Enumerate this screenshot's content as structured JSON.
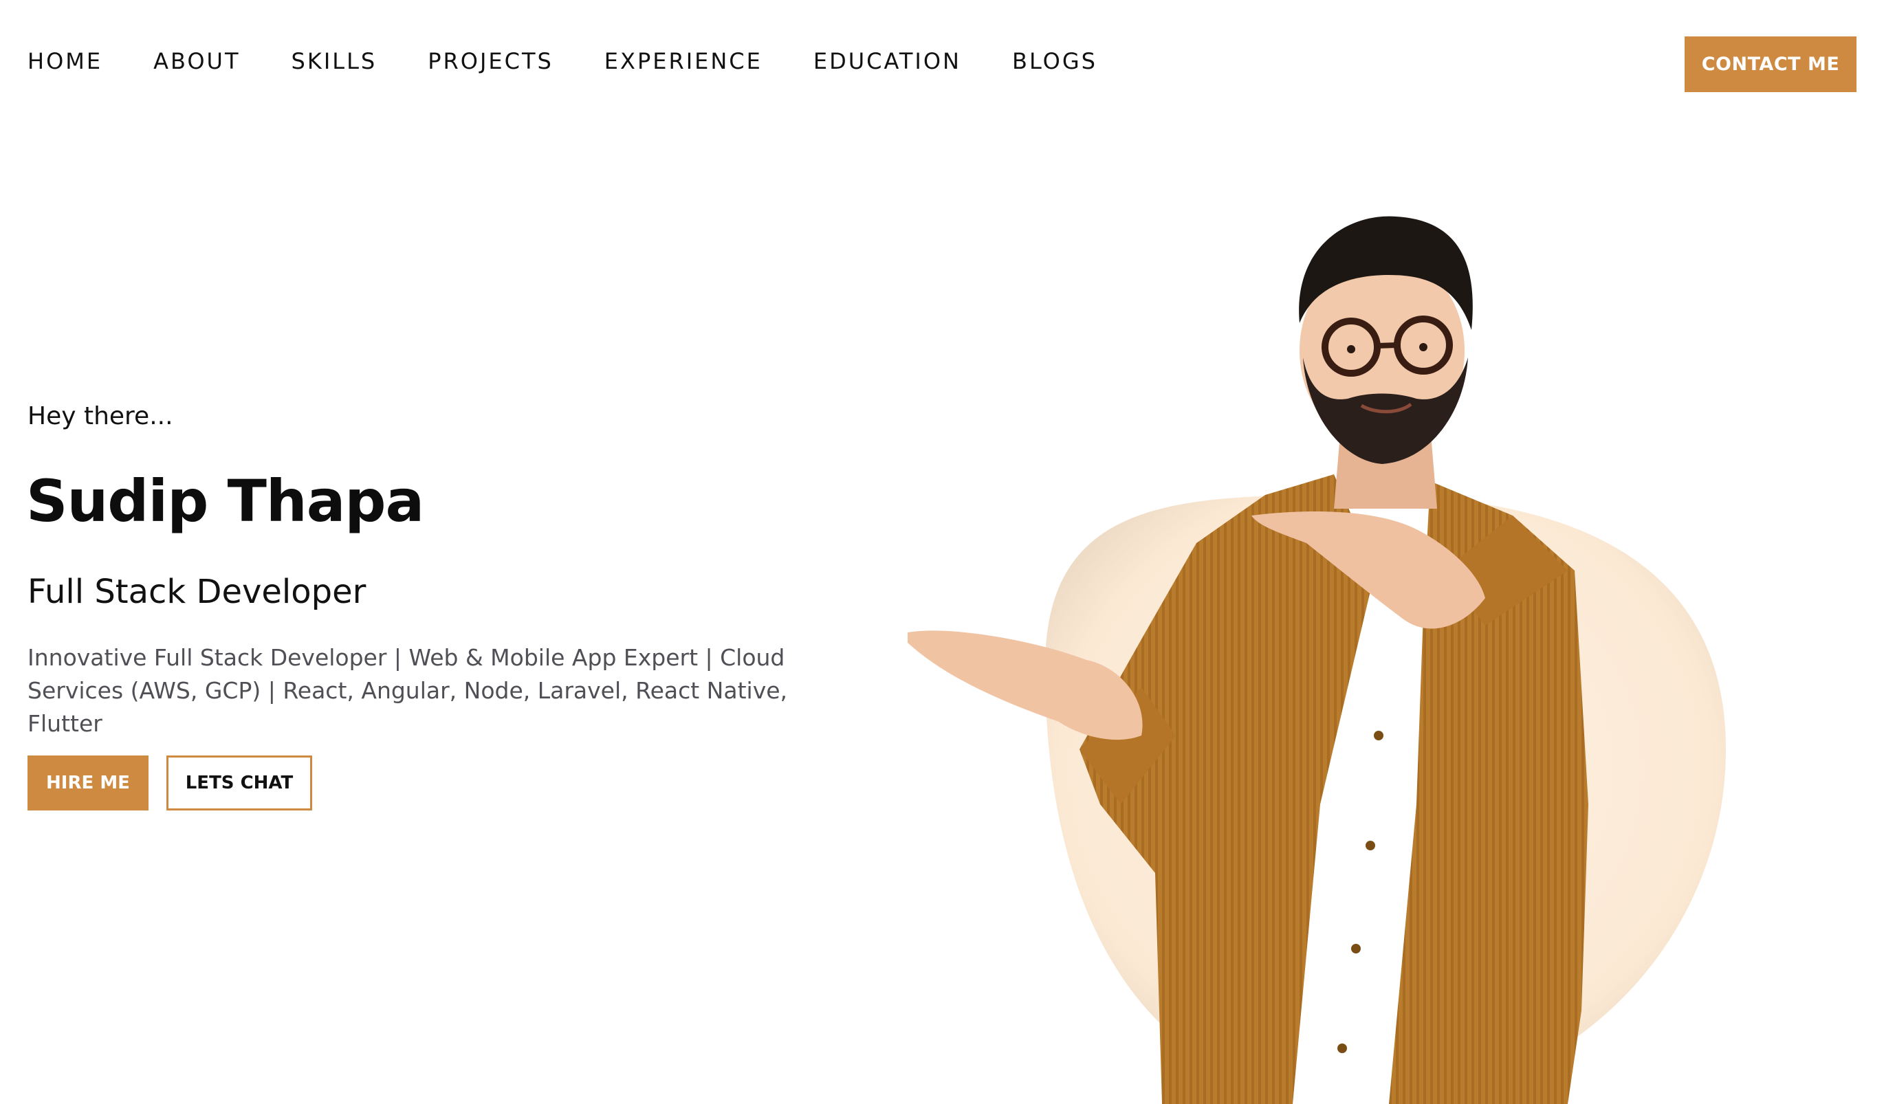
{
  "nav": {
    "items": [
      {
        "label": "HOME"
      },
      {
        "label": "ABOUT"
      },
      {
        "label": "SKILLS"
      },
      {
        "label": "PROJECTS"
      },
      {
        "label": "EXPERIENCE"
      },
      {
        "label": "EDUCATION"
      },
      {
        "label": "BLOGS"
      }
    ],
    "contact_label": "CONTACT ME"
  },
  "hero": {
    "greeting": "Hey there...",
    "name": "Sudip Thapa",
    "role": "Full Stack Developer",
    "tagline": "Innovative Full Stack Developer | Web & Mobile App Expert | Cloud Services (AWS, GCP) | React, Angular, Node, Laravel, React Native, Flutter",
    "hire_label": "HIRE ME",
    "chat_label": "LETS CHAT"
  },
  "colors": {
    "accent": "#cf8a41",
    "circle": "#fbe9d4",
    "jacket": "#b97b2c",
    "text": "#111111",
    "muted": "#4f4f55"
  },
  "icons": {
    "portrait": "portrait-illustration"
  }
}
